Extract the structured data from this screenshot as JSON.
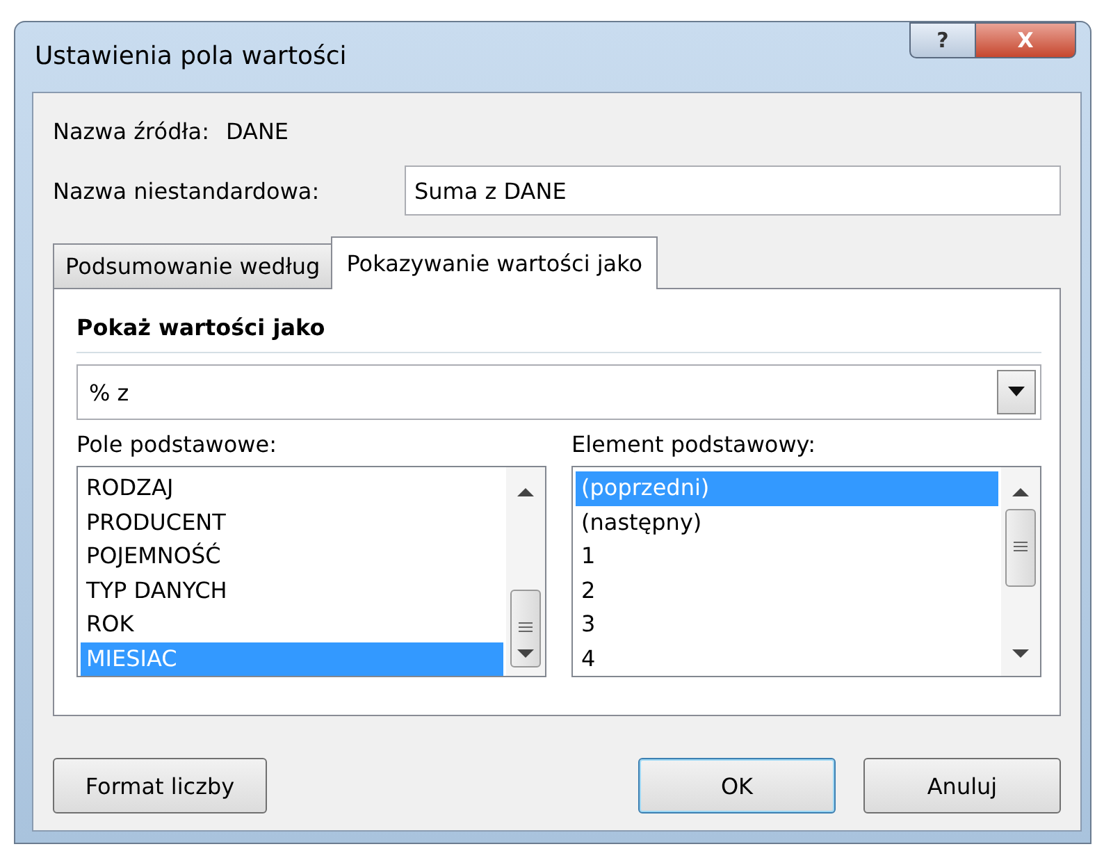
{
  "window": {
    "title": "Ustawienia pola wartości",
    "help_button": "?",
    "close_button": "X"
  },
  "source": {
    "label": "Nazwa źródła:",
    "value": "DANE"
  },
  "custom_name": {
    "label": "Nazwa niestandardowa:",
    "value": "Suma z DANE"
  },
  "tabs": [
    {
      "label": "Podsumowanie według",
      "selected": false
    },
    {
      "label": "Pokazywanie wartości jako",
      "selected": true
    }
  ],
  "section_title": "Pokaż wartości jako",
  "show_as": {
    "value": "% z"
  },
  "base_field": {
    "label": "Pole podstawowe:",
    "items": [
      {
        "label": "RODZAJ",
        "selected": false
      },
      {
        "label": "PRODUCENT",
        "selected": false
      },
      {
        "label": "POJEMNOŚĆ",
        "selected": false
      },
      {
        "label": "TYP DANYCH",
        "selected": false
      },
      {
        "label": "ROK",
        "selected": false
      },
      {
        "label": "MIESIAC",
        "selected": true
      }
    ]
  },
  "base_item": {
    "label": "Element podstawowy:",
    "items": [
      {
        "label": "(poprzedni)",
        "selected": true
      },
      {
        "label": "(następny)",
        "selected": false
      },
      {
        "label": "1",
        "selected": false
      },
      {
        "label": "2",
        "selected": false
      },
      {
        "label": "3",
        "selected": false
      },
      {
        "label": "4",
        "selected": false
      }
    ]
  },
  "buttons": [
    {
      "label": "Format liczby",
      "kind": "left"
    },
    {
      "label": "OK",
      "kind": "default"
    },
    {
      "label": "Anuluj",
      "kind": "normal"
    }
  ]
}
